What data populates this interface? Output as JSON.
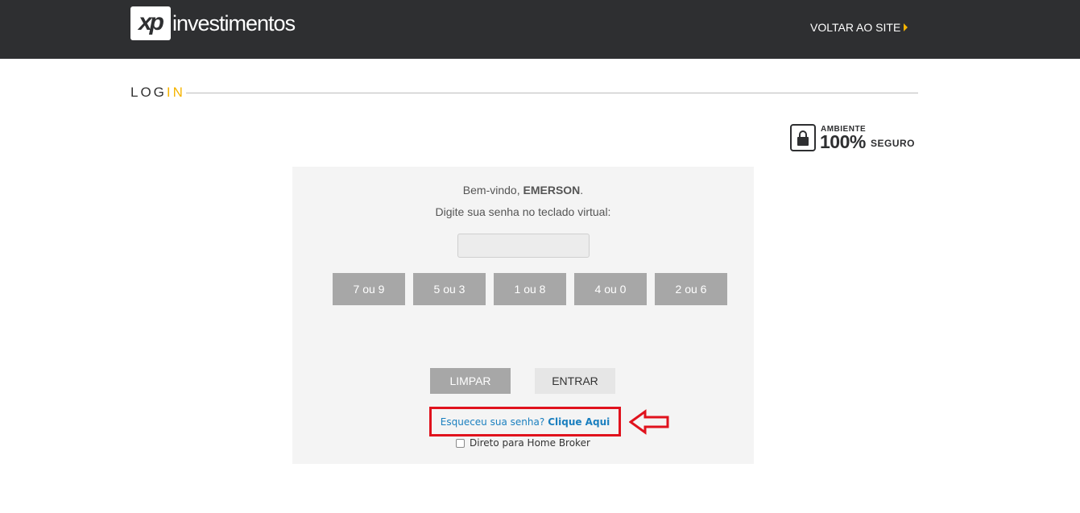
{
  "header": {
    "logo_mark": "xp",
    "logo_text": "investimentos",
    "back_link": "VOLTAR AO SITE",
    "colors": {
      "bar": "#2e2f31",
      "accent": "#f5b400"
    }
  },
  "section": {
    "title_main": "LOG",
    "title_accent": "IN"
  },
  "secure_badge": {
    "line1": "AMBIENTE",
    "percent": "100%",
    "line2": "SEGURO",
    "icon": "lock-icon"
  },
  "login": {
    "welcome_prefix": "Bem-vindo, ",
    "user_name": "EMERSON",
    "welcome_suffix": ".",
    "instruction": "Digite sua senha no teclado virtual:",
    "password_value": "",
    "keys": [
      "7 ou 9",
      "5 ou 3",
      "1 ou 8",
      "4 ou 0",
      "2 ou 6"
    ],
    "clear_label": "LIMPAR",
    "enter_label": "ENTRAR",
    "forgot_text": "Esqueceu sua senha?",
    "forgot_link": "Clique Aqui",
    "home_broker_label": "Direto para Home Broker",
    "home_broker_checked": false
  },
  "annotation": {
    "highlight_color": "#e0121d",
    "arrow_icon": "left-arrow-icon"
  }
}
